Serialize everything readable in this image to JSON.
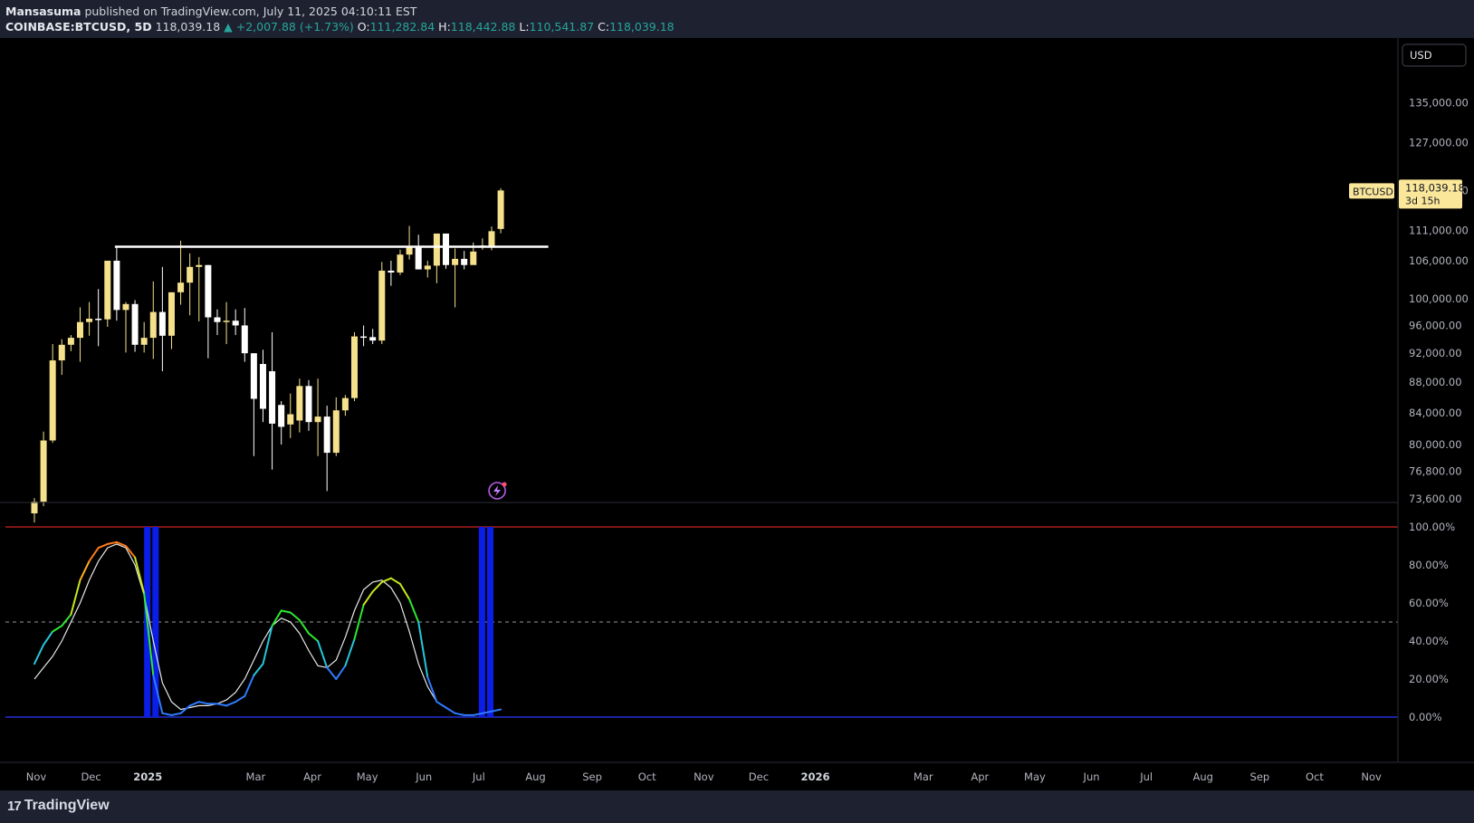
{
  "header": {
    "author": "Mansasuma",
    "published_text": "published on TradingView.com, July 11, 2025 04:10:11 EST",
    "symbol": "COINBASE:BTCUSD, 5D",
    "last": "118,039.18",
    "change": "▲ +2,007.88 (+1.73%)",
    "o_label": "O:",
    "o_value": "111,282.84",
    "h_label": "H:",
    "h_value": "118,442.88",
    "l_label": "L:",
    "l_value": "110,541.87",
    "c_label": "C:",
    "c_value": "118,039.18"
  },
  "footer": {
    "logo_mark": "17",
    "logo_text": "TradingView"
  },
  "colors": {
    "bull": "#f5e08c",
    "bear": "#ffffff",
    "resistance": "#ffffff",
    "overbought": "#ff2b2b",
    "oversold": "#2a3bff",
    "highlight": "#0a1ee8",
    "signal": "#e8e8e8",
    "badge": "#fbe79a"
  },
  "chart_data": [
    {
      "type": "candlestick",
      "symbol": "BTCUSD",
      "currency": "USD",
      "scale": "log",
      "ylim": [
        73600,
        140000
      ],
      "y_ticks": [
        {
          "v": 135000,
          "label": "135,000.00"
        },
        {
          "v": 127000,
          "label": "127,000.00"
        },
        {
          "v": 111000,
          "label": "111,000.00"
        },
        {
          "v": 106000,
          "label": "106,000.00"
        },
        {
          "v": 100000,
          "label": "100,000.00"
        },
        {
          "v": 96000,
          "label": "96,000.00"
        },
        {
          "v": 92000,
          "label": "92,000.00"
        },
        {
          "v": 88000,
          "label": "88,000.00"
        },
        {
          "v": 84000,
          "label": "84,000.00"
        },
        {
          "v": 80000,
          "label": "80,000.00"
        },
        {
          "v": 76800,
          "label": "76,800.00"
        },
        {
          "v": 73600,
          "label": "73,600.00"
        }
      ],
      "hidden_tick_label": "118,000.00",
      "last_price": {
        "value": 118039.18,
        "label": "118,039.18",
        "countdown": "3d 15h",
        "tag": "BTCUSD"
      },
      "resistance": {
        "value": 108300,
        "from": "2024-12-14",
        "to": "2025-08-08"
      },
      "x_axis": [
        {
          "date": "2024-11-01",
          "label": "Nov"
        },
        {
          "date": "2024-12-01",
          "label": "Dec"
        },
        {
          "date": "2025-01-01",
          "label": "2025"
        },
        {
          "date": "2025-03-01",
          "label": "Mar"
        },
        {
          "date": "2025-04-01",
          "label": "Apr"
        },
        {
          "date": "2025-05-01",
          "label": "May"
        },
        {
          "date": "2025-06-01",
          "label": "Jun"
        },
        {
          "date": "2025-07-01",
          "label": "Jul"
        },
        {
          "date": "2025-08-01",
          "label": "Aug"
        },
        {
          "date": "2025-09-01",
          "label": "Sep"
        },
        {
          "date": "2025-10-01",
          "label": "Oct"
        },
        {
          "date": "2025-11-01",
          "label": "Nov"
        },
        {
          "date": "2025-12-01",
          "label": "Dec"
        },
        {
          "date": "2026-01-01",
          "label": "2026"
        },
        {
          "date": "2026-03-01",
          "label": "Mar"
        },
        {
          "date": "2026-04-01",
          "label": "Apr"
        },
        {
          "date": "2026-05-01",
          "label": "May"
        },
        {
          "date": "2026-06-01",
          "label": "Jun"
        },
        {
          "date": "2026-07-01",
          "label": "Jul"
        },
        {
          "date": "2026-08-01",
          "label": "Aug"
        },
        {
          "date": "2026-09-01",
          "label": "Sep"
        },
        {
          "date": "2026-10-01",
          "label": "Oct"
        },
        {
          "date": "2026-11-01",
          "label": "Nov"
        }
      ],
      "candles": [
        {
          "d": "2024-10-31",
          "o": 72000,
          "h": 73700,
          "l": 71000,
          "c": 73300
        },
        {
          "d": "2024-11-05",
          "o": 73300,
          "h": 81600,
          "l": 72800,
          "c": 80500
        },
        {
          "d": "2024-11-10",
          "o": 80500,
          "h": 93300,
          "l": 80200,
          "c": 91000
        },
        {
          "d": "2024-11-15",
          "o": 91000,
          "h": 94000,
          "l": 89000,
          "c": 93200
        },
        {
          "d": "2024-11-20",
          "o": 93200,
          "h": 94600,
          "l": 92300,
          "c": 94200
        },
        {
          "d": "2024-11-25",
          "o": 94200,
          "h": 98700,
          "l": 90800,
          "c": 96500
        },
        {
          "d": "2024-11-30",
          "o": 96500,
          "h": 99500,
          "l": 94500,
          "c": 97000
        },
        {
          "d": "2024-12-05",
          "o": 97000,
          "h": 101500,
          "l": 93000,
          "c": 96900
        },
        {
          "d": "2024-12-10",
          "o": 96900,
          "h": 106000,
          "l": 95800,
          "c": 106000
        },
        {
          "d": "2024-12-15",
          "o": 106000,
          "h": 108300,
          "l": 96700,
          "c": 98300
        },
        {
          "d": "2024-12-20",
          "o": 98300,
          "h": 99500,
          "l": 92100,
          "c": 99200
        },
        {
          "d": "2024-12-25",
          "o": 99200,
          "h": 99800,
          "l": 92200,
          "c": 93200
        },
        {
          "d": "2024-12-30",
          "o": 93200,
          "h": 96500,
          "l": 92100,
          "c": 94200
        },
        {
          "d": "2025-01-04",
          "o": 94200,
          "h": 102700,
          "l": 91200,
          "c": 98000
        },
        {
          "d": "2025-01-09",
          "o": 98000,
          "h": 105000,
          "l": 89500,
          "c": 94500
        },
        {
          "d": "2025-01-14",
          "o": 94500,
          "h": 101000,
          "l": 92600,
          "c": 101000
        },
        {
          "d": "2025-01-19",
          "o": 101000,
          "h": 109300,
          "l": 99100,
          "c": 102500
        },
        {
          "d": "2025-01-24",
          "o": 102500,
          "h": 107200,
          "l": 97500,
          "c": 105000
        },
        {
          "d": "2025-01-29",
          "o": 105000,
          "h": 106600,
          "l": 96600,
          "c": 105300
        },
        {
          "d": "2025-02-03",
          "o": 105300,
          "h": 105300,
          "l": 91300,
          "c": 97200
        },
        {
          "d": "2025-02-08",
          "o": 97200,
          "h": 98400,
          "l": 94600,
          "c": 96500
        },
        {
          "d": "2025-02-13",
          "o": 96500,
          "h": 99500,
          "l": 93300,
          "c": 96700
        },
        {
          "d": "2025-02-18",
          "o": 96700,
          "h": 98400,
          "l": 94600,
          "c": 96000
        },
        {
          "d": "2025-02-23",
          "o": 96000,
          "h": 98600,
          "l": 90800,
          "c": 92000
        },
        {
          "d": "2025-02-28",
          "o": 92000,
          "h": 92000,
          "l": 78600,
          "c": 85800
        },
        {
          "d": "2025-03-05",
          "o": 90500,
          "h": 92500,
          "l": 82800,
          "c": 84500
        },
        {
          "d": "2025-03-10",
          "o": 89500,
          "h": 95000,
          "l": 77000,
          "c": 82600
        },
        {
          "d": "2025-03-15",
          "o": 85000,
          "h": 85500,
          "l": 80000,
          "c": 82200
        },
        {
          "d": "2025-03-20",
          "o": 82500,
          "h": 86500,
          "l": 80800,
          "c": 83800
        },
        {
          "d": "2025-03-25",
          "o": 83000,
          "h": 88500,
          "l": 81500,
          "c": 87500
        },
        {
          "d": "2025-03-30",
          "o": 87500,
          "h": 88300,
          "l": 81700,
          "c": 82800
        },
        {
          "d": "2025-04-04",
          "o": 82800,
          "h": 88500,
          "l": 78600,
          "c": 83500
        },
        {
          "d": "2025-04-09",
          "o": 83500,
          "h": 84900,
          "l": 74500,
          "c": 79000
        },
        {
          "d": "2025-04-14",
          "o": 79000,
          "h": 86000,
          "l": 78600,
          "c": 84300
        },
        {
          "d": "2025-04-19",
          "o": 84300,
          "h": 86300,
          "l": 83600,
          "c": 85900
        },
        {
          "d": "2025-04-24",
          "o": 85900,
          "h": 95000,
          "l": 85500,
          "c": 94400
        },
        {
          "d": "2025-04-29",
          "o": 94400,
          "h": 96000,
          "l": 93000,
          "c": 94300
        },
        {
          "d": "2025-05-04",
          "o": 94300,
          "h": 95500,
          "l": 93300,
          "c": 93800
        },
        {
          "d": "2025-05-09",
          "o": 93800,
          "h": 105800,
          "l": 93300,
          "c": 104400
        },
        {
          "d": "2025-05-14",
          "o": 104400,
          "h": 106000,
          "l": 102000,
          "c": 104100
        },
        {
          "d": "2025-05-19",
          "o": 104100,
          "h": 107800,
          "l": 103700,
          "c": 107000
        },
        {
          "d": "2025-05-24",
          "o": 107000,
          "h": 111800,
          "l": 106200,
          "c": 108400
        },
        {
          "d": "2025-05-29",
          "o": 108400,
          "h": 110300,
          "l": 104600,
          "c": 104600
        },
        {
          "d": "2025-06-03",
          "o": 104600,
          "h": 106000,
          "l": 103300,
          "c": 105200
        },
        {
          "d": "2025-06-08",
          "o": 105200,
          "h": 110500,
          "l": 102400,
          "c": 110500
        },
        {
          "d": "2025-06-13",
          "o": 110500,
          "h": 110500,
          "l": 104700,
          "c": 105300
        },
        {
          "d": "2025-06-18",
          "o": 105300,
          "h": 108000,
          "l": 98700,
          "c": 106300
        },
        {
          "d": "2025-06-23",
          "o": 106300,
          "h": 107600,
          "l": 104600,
          "c": 105300
        },
        {
          "d": "2025-06-28",
          "o": 105300,
          "h": 109000,
          "l": 105600,
          "c": 107500
        },
        {
          "d": "2025-07-03",
          "o": 108300,
          "h": 109700,
          "l": 107800,
          "c": 108500
        },
        {
          "d": "2025-07-08",
          "o": 108300,
          "h": 111700,
          "l": 107700,
          "c": 110900
        },
        {
          "d": "2025-07-13",
          "o": 111282.84,
          "h": 118442.88,
          "l": 110541.87,
          "c": 118039.18
        }
      ]
    },
    {
      "type": "line",
      "name": "oscillator",
      "ylim": [
        0,
        100
      ],
      "y_ticks": [
        {
          "v": 100,
          "label": "100.00%"
        },
        {
          "v": 80,
          "label": "80.00%"
        },
        {
          "v": 60,
          "label": "60.00%"
        },
        {
          "v": 40,
          "label": "40.00%"
        },
        {
          "v": 20,
          "label": "20.00%"
        },
        {
          "v": 0,
          "label": "0.00%"
        }
      ],
      "levels": {
        "overbought": 100,
        "mid": 50,
        "oversold": 0
      },
      "highlight_ranges": [
        [
          "2024-12-30",
          "2025-01-07"
        ],
        [
          "2025-07-01",
          "2025-07-09"
        ]
      ],
      "k": [
        {
          "d": "2024-10-31",
          "v": 28
        },
        {
          "d": "2024-11-05",
          "v": 38
        },
        {
          "d": "2024-11-10",
          "v": 45
        },
        {
          "d": "2024-11-15",
          "v": 48
        },
        {
          "d": "2024-11-20",
          "v": 54
        },
        {
          "d": "2024-11-25",
          "v": 72
        },
        {
          "d": "2024-11-30",
          "v": 82
        },
        {
          "d": "2024-12-05",
          "v": 89
        },
        {
          "d": "2024-12-10",
          "v": 91
        },
        {
          "d": "2024-12-15",
          "v": 92
        },
        {
          "d": "2024-12-20",
          "v": 90
        },
        {
          "d": "2024-12-25",
          "v": 84
        },
        {
          "d": "2024-12-30",
          "v": 65
        },
        {
          "d": "2025-01-04",
          "v": 22
        },
        {
          "d": "2025-01-09",
          "v": 2
        },
        {
          "d": "2025-01-14",
          "v": 1
        },
        {
          "d": "2025-01-19",
          "v": 2
        },
        {
          "d": "2025-01-24",
          "v": 6
        },
        {
          "d": "2025-01-29",
          "v": 8
        },
        {
          "d": "2025-02-03",
          "v": 7
        },
        {
          "d": "2025-02-08",
          "v": 7
        },
        {
          "d": "2025-02-13",
          "v": 6
        },
        {
          "d": "2025-02-18",
          "v": 8
        },
        {
          "d": "2025-02-23",
          "v": 11
        },
        {
          "d": "2025-02-28",
          "v": 22
        },
        {
          "d": "2025-03-05",
          "v": 28
        },
        {
          "d": "2025-03-10",
          "v": 48
        },
        {
          "d": "2025-03-15",
          "v": 56
        },
        {
          "d": "2025-03-20",
          "v": 55
        },
        {
          "d": "2025-03-25",
          "v": 51
        },
        {
          "d": "2025-03-30",
          "v": 44
        },
        {
          "d": "2025-04-04",
          "v": 40
        },
        {
          "d": "2025-04-09",
          "v": 26
        },
        {
          "d": "2025-04-14",
          "v": 20
        },
        {
          "d": "2025-04-19",
          "v": 27
        },
        {
          "d": "2025-04-24",
          "v": 41
        },
        {
          "d": "2025-04-29",
          "v": 59
        },
        {
          "d": "2025-05-04",
          "v": 66
        },
        {
          "d": "2025-05-09",
          "v": 71
        },
        {
          "d": "2025-05-14",
          "v": 73
        },
        {
          "d": "2025-05-19",
          "v": 70
        },
        {
          "d": "2025-05-24",
          "v": 62
        },
        {
          "d": "2025-05-29",
          "v": 50
        },
        {
          "d": "2025-06-03",
          "v": 21
        },
        {
          "d": "2025-06-08",
          "v": 8
        },
        {
          "d": "2025-06-13",
          "v": 5
        },
        {
          "d": "2025-06-18",
          "v": 2
        },
        {
          "d": "2025-06-23",
          "v": 1
        },
        {
          "d": "2025-06-28",
          "v": 1
        },
        {
          "d": "2025-07-03",
          "v": 2
        },
        {
          "d": "2025-07-08",
          "v": 3
        },
        {
          "d": "2025-07-13",
          "v": 4
        }
      ],
      "d": [
        {
          "d": "2024-10-31",
          "v": 20
        },
        {
          "d": "2024-11-05",
          "v": 26
        },
        {
          "d": "2024-11-10",
          "v": 32
        },
        {
          "d": "2024-11-15",
          "v": 40
        },
        {
          "d": "2024-11-20",
          "v": 50
        },
        {
          "d": "2024-11-25",
          "v": 60
        },
        {
          "d": "2024-11-30",
          "v": 72
        },
        {
          "d": "2024-12-05",
          "v": 82
        },
        {
          "d": "2024-12-10",
          "v": 89
        },
        {
          "d": "2024-12-15",
          "v": 91
        },
        {
          "d": "2024-12-20",
          "v": 89
        },
        {
          "d": "2024-12-25",
          "v": 80
        },
        {
          "d": "2024-12-30",
          "v": 64
        },
        {
          "d": "2025-01-04",
          "v": 40
        },
        {
          "d": "2025-01-09",
          "v": 18
        },
        {
          "d": "2025-01-14",
          "v": 8
        },
        {
          "d": "2025-01-19",
          "v": 4
        },
        {
          "d": "2025-01-24",
          "v": 5
        },
        {
          "d": "2025-01-29",
          "v": 6
        },
        {
          "d": "2025-02-03",
          "v": 6
        },
        {
          "d": "2025-02-08",
          "v": 7
        },
        {
          "d": "2025-02-13",
          "v": 9
        },
        {
          "d": "2025-02-18",
          "v": 13
        },
        {
          "d": "2025-02-23",
          "v": 20
        },
        {
          "d": "2025-02-28",
          "v": 30
        },
        {
          "d": "2025-03-05",
          "v": 40
        },
        {
          "d": "2025-03-10",
          "v": 48
        },
        {
          "d": "2025-03-15",
          "v": 52
        },
        {
          "d": "2025-03-20",
          "v": 50
        },
        {
          "d": "2025-03-25",
          "v": 44
        },
        {
          "d": "2025-03-30",
          "v": 35
        },
        {
          "d": "2025-04-04",
          "v": 27
        },
        {
          "d": "2025-04-09",
          "v": 26
        },
        {
          "d": "2025-04-14",
          "v": 30
        },
        {
          "d": "2025-04-19",
          "v": 42
        },
        {
          "d": "2025-04-24",
          "v": 56
        },
        {
          "d": "2025-04-29",
          "v": 67
        },
        {
          "d": "2025-05-04",
          "v": 71
        },
        {
          "d": "2025-05-09",
          "v": 72
        },
        {
          "d": "2025-05-14",
          "v": 68
        },
        {
          "d": "2025-05-19",
          "v": 60
        },
        {
          "d": "2025-05-24",
          "v": 45
        },
        {
          "d": "2025-05-29",
          "v": 28
        },
        {
          "d": "2025-06-03",
          "v": 16
        },
        {
          "d": "2025-06-08",
          "v": 8
        }
      ]
    }
  ]
}
